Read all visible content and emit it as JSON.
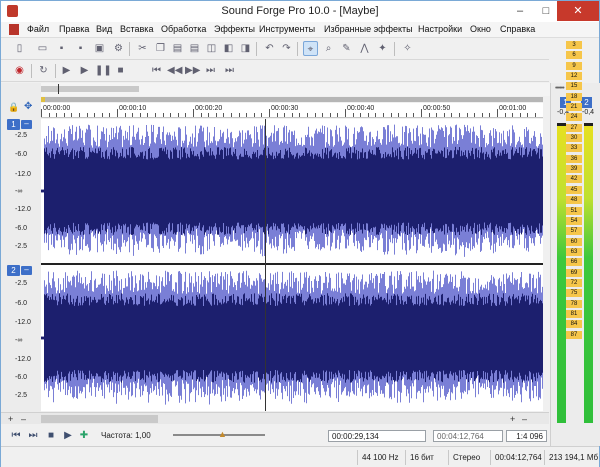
{
  "window": {
    "title": "Sound Forge Pro 10.0 - [Maybe]",
    "minimize": "–",
    "maximize": "□",
    "close": "✕"
  },
  "menu": [
    "Файл",
    "Правка",
    "Вид",
    "Вставка",
    "Обработка",
    "Эффекты",
    "Инструменты",
    "Избранные эффекты",
    "Настройки",
    "Окно",
    "Справка"
  ],
  "toolbar1_icons": [
    "new-icon",
    "open-icon",
    "save-icon",
    "save-all-icon",
    "render-icon",
    "properties-icon",
    "cut-icon",
    "copy-icon",
    "paste-icon",
    "paste-special-icon",
    "mix-icon",
    "crop-icon",
    "trim-icon",
    "undo-icon",
    "redo-icon",
    "repeat-icon",
    "edit-tool-icon",
    "magnify-tool-icon",
    "pencil-tool-icon",
    "envelope-tool-icon",
    "event-tool-icon",
    "plugin-chainer-icon"
  ],
  "toolbar2_icons": [
    "record-icon",
    "loop-icon",
    "play-all-icon",
    "play-icon",
    "pause-icon",
    "stop-icon",
    "go-start-icon",
    "rewind-icon",
    "forward-icon",
    "go-end-icon"
  ],
  "ruler_labels": [
    "00:00:00",
    "00:00:10",
    "00:00:20",
    "00:00:30",
    "00:00:40",
    "00:00:50",
    "00:01:00"
  ],
  "channels": [
    {
      "id": "1",
      "db_labels": [
        "-2.5",
        "-6.0",
        "-12.0",
        "-∞",
        "-12.0",
        "-6.0",
        "-2.5"
      ]
    },
    {
      "id": "2",
      "db_labels": [
        "-2.5",
        "-6.0",
        "-12.0",
        "-∞",
        "-12.0",
        "-6.0",
        "-2.5"
      ]
    }
  ],
  "transport": {
    "rate_label": "Частота: 1,00",
    "position": "00:00:29,134",
    "length": "00:04:12,764",
    "zoom": "1:4 096"
  },
  "meters": {
    "dots": "••••••",
    "ch1": "1",
    "ch2": "2",
    "peak1": "-0,4",
    "peak2": "-0,4",
    "scale": [
      "3",
      "6",
      "9",
      "12",
      "15",
      "18",
      "21",
      "24",
      "27",
      "30",
      "33",
      "36",
      "39",
      "42",
      "45",
      "48",
      "51",
      "54",
      "57",
      "60",
      "63",
      "66",
      "69",
      "72",
      "75",
      "78",
      "81",
      "84",
      "87"
    ]
  },
  "status": {
    "rate": "44 100 Hz",
    "bits": "16 бит",
    "mode": "Стерео",
    "duration": "00:04:12,764",
    "size": "213 194,1 Мб"
  },
  "colors": {
    "waveform": "#1c1f6e",
    "waveform_peak": "#7a7fd6",
    "accent": "#3d6fc8"
  }
}
